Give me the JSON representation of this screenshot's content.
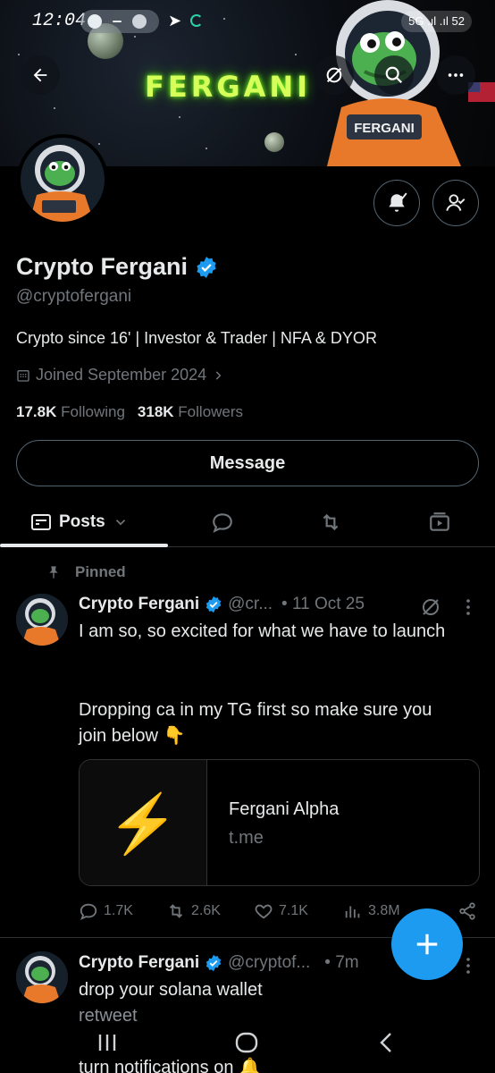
{
  "status_bar": {
    "time": "12:04",
    "right_label": "5G .ıl .ıl 52"
  },
  "banner": {
    "title": "FERGANI",
    "patch_text": "FERGANI"
  },
  "profile": {
    "name": "Crypto Fergani",
    "handle": "@cryptofergani",
    "bio": "Crypto since 16' | Investor & Trader | NFA & DYOR",
    "joined": "Joined September 2024",
    "following_count": "17.8K",
    "following_label": "Following",
    "followers_count": "318K",
    "followers_label": "Followers",
    "message_label": "Message"
  },
  "tabs": {
    "posts_label": "Posts"
  },
  "posts": [
    {
      "pinned_label": "Pinned",
      "name": "Crypto Fergani",
      "handle": "@cr...",
      "date": "• 11 Oct 25",
      "text_line1": "I am so, so excited for what we have to launch",
      "text_line2": "Dropping ca in my TG first so make sure you join below 👇",
      "card_title": "Fergani Alpha",
      "card_domain": "t.me",
      "card_emoji": "⚡",
      "replies": "1.7K",
      "reposts": "2.6K",
      "likes": "7.1K",
      "views": "3.8M"
    },
    {
      "name": "Crypto Fergani",
      "handle": "@cryptof...",
      "date": "• 7m",
      "text_line1": "drop your solana wallet",
      "text_line2": "retweet",
      "text_line3": "turn notifications on 🔔"
    }
  ],
  "colors": {
    "accent": "#1d9bf0",
    "muted": "#71767b",
    "text": "#e7e9ea",
    "border": "#2f3336"
  }
}
